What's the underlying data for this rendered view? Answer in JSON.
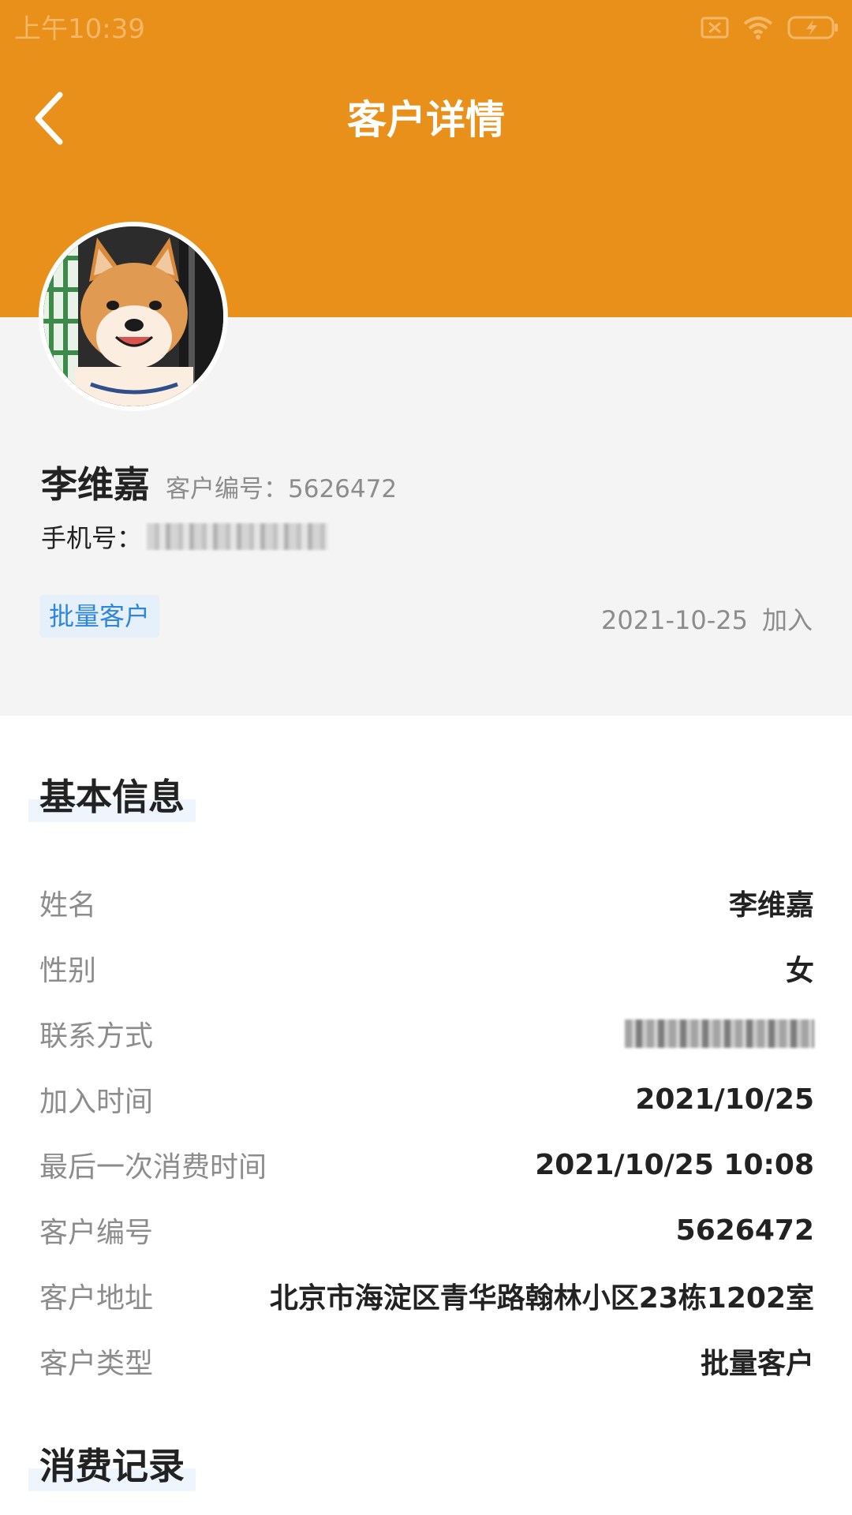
{
  "status_bar": {
    "time": "上午10:39"
  },
  "nav": {
    "title": "客户详情"
  },
  "profile": {
    "name": "李维嘉",
    "customer_no_label": "客户编号：",
    "customer_no": "5626472",
    "phone_label": "手机号：",
    "phone_value": "13080092142",
    "customer_type_tag": "批量客户",
    "join_date": "2021-10-25",
    "join_suffix": "加入"
  },
  "basic_info": {
    "title": "基本信息",
    "rows": [
      {
        "label": "姓名",
        "value": "李维嘉"
      },
      {
        "label": "性别",
        "value": "女"
      },
      {
        "label": "联系方式",
        "value": "13080092142"
      },
      {
        "label": "加入时间",
        "value": "2021/10/25"
      },
      {
        "label": "最后一次消费时间",
        "value": "2021/10/25 10:08"
      },
      {
        "label": "客户编号",
        "value": "5626472"
      },
      {
        "label": "客户地址",
        "value": "北京市海淀区青华路翰林小区23栋1202室"
      },
      {
        "label": "客户类型",
        "value": "批量客户"
      }
    ]
  },
  "consumption_records": {
    "title": "消费记录"
  },
  "colors": {
    "header_orange": "#e8901a",
    "tag_blue": "#2e86de",
    "profile_bg": "#f4f4f5"
  }
}
